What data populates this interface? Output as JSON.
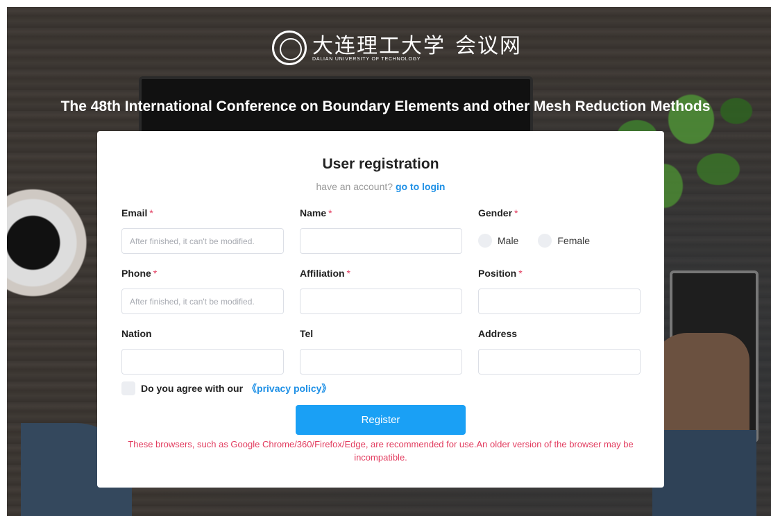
{
  "header": {
    "logo_cn_university": "大连理工大学",
    "logo_cn_site": "会议网",
    "logo_en": "DALIAN UNIVERSITY OF TECHNOLOGY",
    "conference_title": "The 48th International Conference on Boundary Elements and other Mesh Reduction Methods"
  },
  "form": {
    "title": "User registration",
    "login_prompt": "have an account?",
    "login_link": "go to login",
    "required_mark": "*",
    "fields": {
      "email": {
        "label": "Email",
        "placeholder": "After finished, it can't be modified.",
        "value": ""
      },
      "name": {
        "label": "Name",
        "value": ""
      },
      "gender": {
        "label": "Gender",
        "options": [
          "Male",
          "Female"
        ],
        "selected": null
      },
      "phone": {
        "label": "Phone",
        "placeholder": "After finished, it can't be modified.",
        "value": ""
      },
      "affiliation": {
        "label": "Affiliation",
        "value": ""
      },
      "position": {
        "label": "Position",
        "value": ""
      },
      "nation": {
        "label": "Nation",
        "value": ""
      },
      "tel": {
        "label": "Tel",
        "value": ""
      },
      "address": {
        "label": "Address",
        "value": ""
      }
    },
    "agree_text": "Do you agree with our",
    "privacy_link": "《privacy policy》",
    "agree_checked": false,
    "register_label": "Register",
    "browser_notice": "These browsers, such as Google Chrome/360/Firefox/Edge, are recommended for use.An older version of the browser may be incompatible."
  },
  "colors": {
    "accent": "#1aa0f5",
    "link": "#1e90e6",
    "required": "#e23b5e",
    "notice": "#e23b5e"
  }
}
